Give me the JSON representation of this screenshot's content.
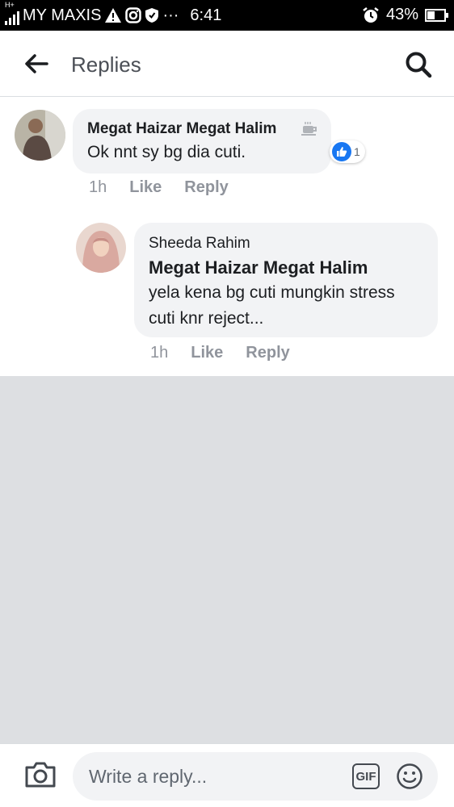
{
  "status_bar": {
    "network_type": "H+",
    "carrier": "MY MAXIS",
    "more_indicator": "···",
    "time": "6:41",
    "battery_level": "43%",
    "battery_fraction": 0.43
  },
  "header": {
    "title": "Replies",
    "back_icon": "arrow-left-icon",
    "search_icon": "search-icon"
  },
  "comments": [
    {
      "author": "Megat Haizar Megat Halim",
      "author_badge": "coffee-cup-icon",
      "text": "Ok nnt sy bg dia cuti.",
      "reaction_count": "1",
      "time": "1h",
      "like_label": "Like",
      "reply_label": "Reply"
    },
    {
      "author": "Sheeda Rahim",
      "mention": "Megat Haizar Megat Halim",
      "text": "yela kena bg cuti mungkin stress cuti knr reject...",
      "time": "1h",
      "like_label": "Like",
      "reply_label": "Reply"
    }
  ],
  "composer": {
    "placeholder": "Write a reply...",
    "gif_label": "GIF",
    "camera_icon": "camera-icon",
    "emoji_icon": "emoji-icon"
  },
  "colors": {
    "status_bar": "#000000",
    "bubble": "#f2f3f5",
    "background_empty": "#dddfe2",
    "like_blue": "#1877f2",
    "meta_text": "#90949c"
  }
}
